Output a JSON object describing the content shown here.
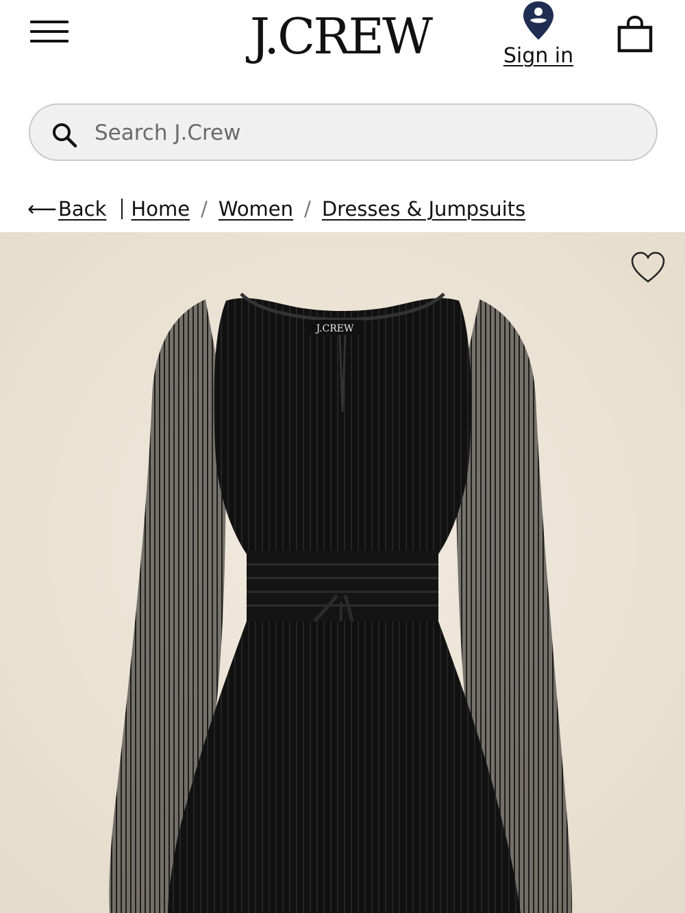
{
  "header": {
    "logo_text": "J.CREW",
    "signin_label": "Sign in",
    "menu_icon": "hamburger-icon",
    "account_icon": "location-pin-user-icon",
    "bag_icon": "shopping-bag-icon"
  },
  "search": {
    "placeholder": "Search J.Crew",
    "value": ""
  },
  "breadcrumb": {
    "back_label": "Back",
    "items": [
      {
        "label": "Home"
      },
      {
        "label": "Women"
      },
      {
        "label": "Dresses & Jumpsuits"
      }
    ]
  },
  "product": {
    "label_text": "J.CREW",
    "favorite_icon": "heart-outline-icon",
    "image_icon": "black-dress-image"
  },
  "colors": {
    "brand_navy": "#1f2d52",
    "image_background": "#ece4d7",
    "dress": "#121212"
  }
}
